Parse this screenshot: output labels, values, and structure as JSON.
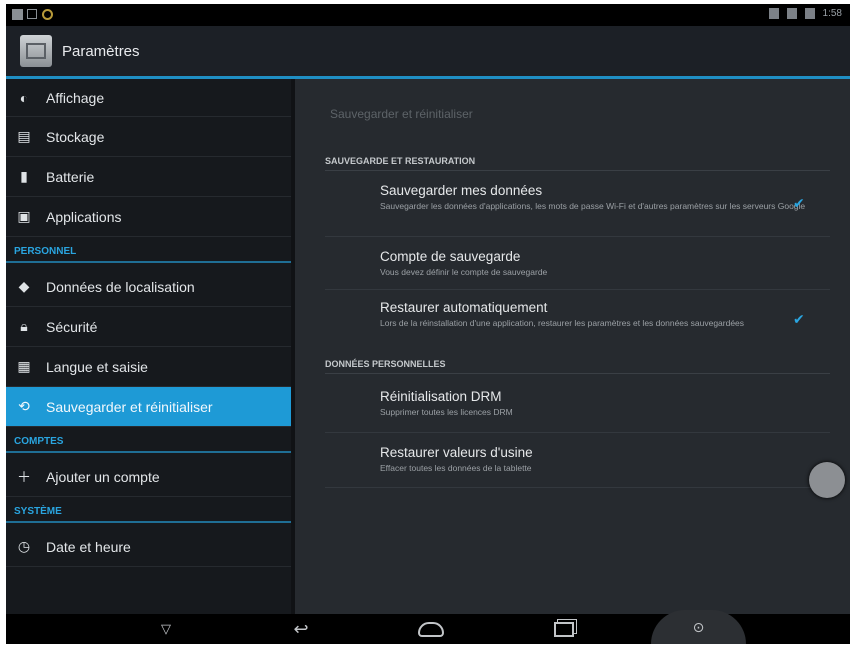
{
  "status_bar": {
    "time": "1:58"
  },
  "action_bar": {
    "title": "Paramètres",
    "app_icon": "settings-app-icon"
  },
  "sidebar": {
    "items_top": [
      {
        "label": "Affichage",
        "icon": "display-icon"
      },
      {
        "label": "Stockage",
        "icon": "storage-icon"
      },
      {
        "label": "Batterie",
        "icon": "battery-icon"
      },
      {
        "label": "Applications",
        "icon": "apps-icon"
      }
    ],
    "header_personnel": "PERSONNEL",
    "items_personnel": [
      {
        "label": "Données de localisation",
        "icon": "location-icon"
      },
      {
        "label": "Sécurité",
        "icon": "lock-icon"
      },
      {
        "label": "Langue et saisie",
        "icon": "keyboard-icon"
      },
      {
        "label": "Sauvegarder et réinitialiser",
        "icon": "backup-icon",
        "selected": true
      }
    ],
    "header_comptes": "COMPTES",
    "items_comptes": [
      {
        "label": "Ajouter un compte",
        "icon": "plus-icon"
      }
    ],
    "header_systeme": "SYSTÈME",
    "items_systeme": [
      {
        "label": "Date et heure",
        "icon": "clock-icon"
      }
    ]
  },
  "content": {
    "breadcrumb": "Sauvegarder et réinitialiser",
    "section_backup": "SAUVEGARDE ET RESTAURATION",
    "prefs_backup": [
      {
        "title": "Sauvegarder mes données",
        "summary": "Sauvegarder les données d'applications, les mots de passe Wi-Fi et d'autres paramètres sur les serveurs Google",
        "checked": true
      },
      {
        "title": "Compte de sauvegarde",
        "summary": "Vous devez définir le compte de sauvegarde",
        "checked": false
      },
      {
        "title": "Restaurer automatiquement",
        "summary": "Lors de la réinstallation d'une application, restaurer les paramètres et les données sauvegardées",
        "checked": true
      }
    ],
    "section_personal": "DONNÉES PERSONNELLES",
    "prefs_personal": [
      {
        "title": "Réinitialisation DRM",
        "summary": "Supprimer toutes les licences DRM"
      },
      {
        "title": "Restaurer valeurs d'usine",
        "summary": "Effacer toutes les données de la tablette"
      }
    ]
  },
  "colors": {
    "accent": "#1e9ad6",
    "background": "#262a2f",
    "sidebar": "#16191d"
  }
}
